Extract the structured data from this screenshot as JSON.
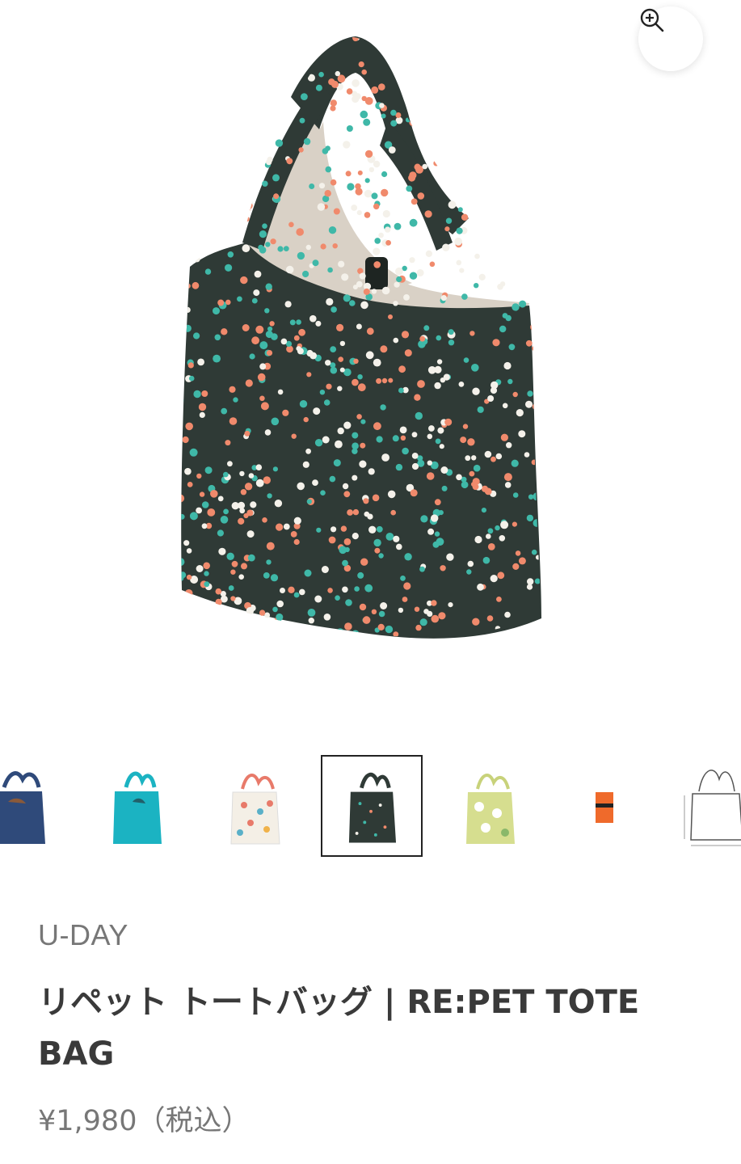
{
  "product": {
    "brand": "U-DAY",
    "title": "リペット トートバッグ | RE:PET TOTE BAG",
    "price": "¥1,980（税込）"
  },
  "gallery": {
    "zoom_icon": "zoom-in-icon",
    "thumbnails": [
      {
        "name": "navy",
        "color": "#2f4a7a",
        "selected": false
      },
      {
        "name": "turquoise",
        "color": "#1bb3c2",
        "selected": false
      },
      {
        "name": "white-pattern",
        "color": "#f4efe6",
        "selected": false
      },
      {
        "name": "dark-green-dots",
        "color": "#2f3a36",
        "selected": true
      },
      {
        "name": "yellow-green-pattern",
        "color": "#d6de8f",
        "selected": false
      },
      {
        "name": "orange-pouch",
        "color": "#ef6a2b",
        "selected": false
      },
      {
        "name": "size-diagram",
        "color": "#ffffff",
        "selected": false
      }
    ]
  },
  "colors": {
    "bag_body": "#2f3a36",
    "bag_lining": "#d9d1c6",
    "dot_teal": "#3fb8a8",
    "dot_coral": "#f08a6c",
    "dot_white": "#f4f1ea"
  }
}
